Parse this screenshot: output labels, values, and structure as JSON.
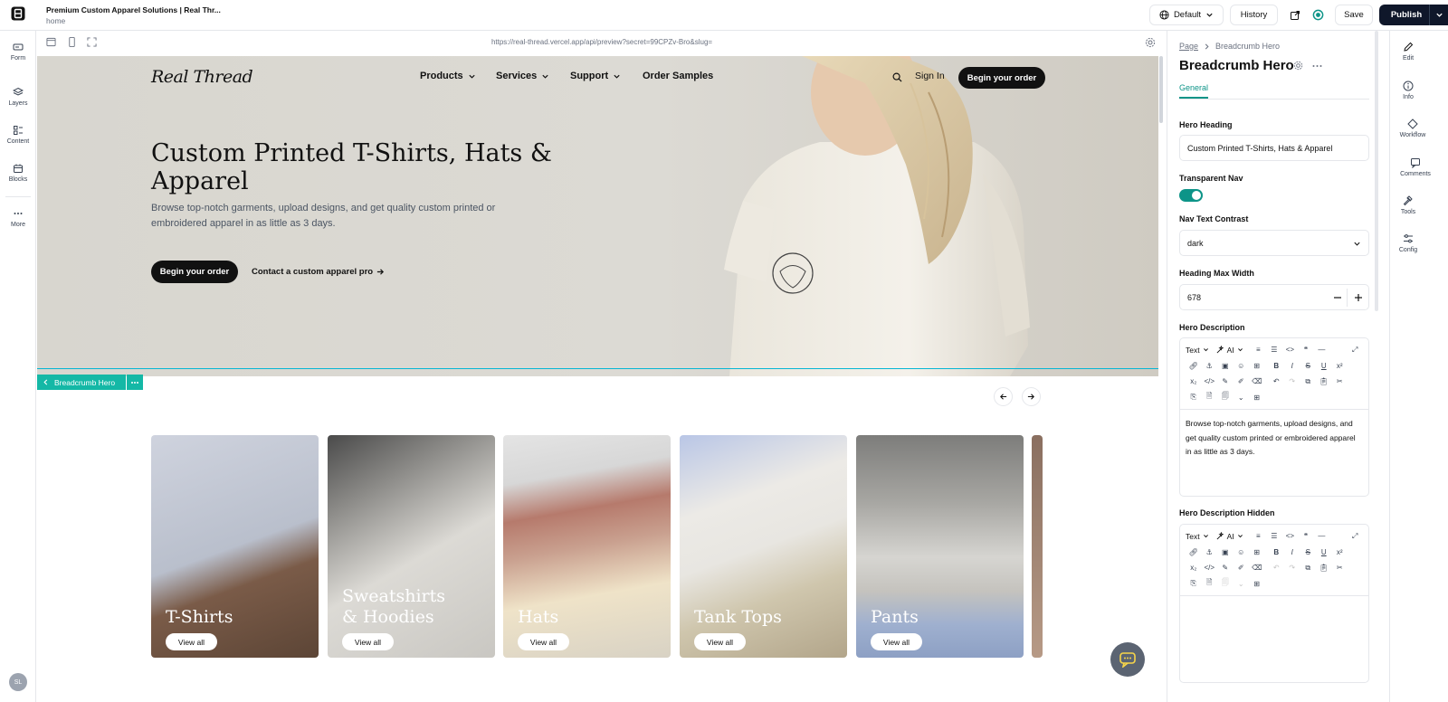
{
  "topbar": {
    "title": "Premium Custom Apparel Solutions | Real Thr...",
    "subtitle": "home",
    "locale_label": "Default",
    "history_label": "History",
    "save_label": "Save",
    "publish_label": "Publish"
  },
  "leftrail": {
    "items": [
      {
        "label": "Form",
        "icon": "form-icon"
      },
      {
        "label": "Layers",
        "icon": "layers-icon"
      },
      {
        "label": "Content",
        "icon": "content-icon"
      },
      {
        "label": "Blocks",
        "icon": "blocks-icon"
      },
      {
        "label": "More",
        "icon": "more-icon"
      }
    ],
    "avatar": "SL"
  },
  "preview": {
    "url": "https://real-thread.vercel.app/api/preview?secret=99CPZv-Bro&slug="
  },
  "site": {
    "brand": "Real Thread",
    "nav": [
      "Products",
      "Services",
      "Support",
      "Order Samples"
    ],
    "signin": "Sign In",
    "nav_cta": "Begin your order",
    "hero_heading": "Custom Printed T-Shirts, Hats & Apparel",
    "hero_description": "Browse top-notch garments, upload designs, and get quality custom printed or embroidered apparel in as little as 3 days.",
    "hero_cta": "Begin your order",
    "hero_link": "Contact a custom apparel pro",
    "selection_label": "Breadcrumb Hero",
    "categories": [
      {
        "title_line1": "T-Shirts",
        "title_line2": "",
        "button": "View all"
      },
      {
        "title_line1": "Sweatshirts",
        "title_line2": "& Hoodies",
        "button": "View all"
      },
      {
        "title_line1": "Hats",
        "title_line2": "",
        "button": "View all"
      },
      {
        "title_line1": "Tank Tops",
        "title_line2": "",
        "button": "View all"
      },
      {
        "title_line1": "Pants",
        "title_line2": "",
        "button": "View all"
      }
    ]
  },
  "panel": {
    "breadcrumb_root": "Page",
    "breadcrumb_current": "Breadcrumb Hero",
    "title": "Breadcrumb Hero",
    "tab": "General",
    "hero_heading_label": "Hero Heading",
    "hero_heading_value": "Custom Printed T-Shirts, Hats & Apparel",
    "transparent_nav_label": "Transparent Nav",
    "transparent_nav_on": true,
    "nav_contrast_label": "Nav Text Contrast",
    "nav_contrast_value": "dark",
    "max_width_label": "Heading Max Width",
    "max_width_value": "678",
    "hero_description_label": "Hero Description",
    "hero_description_value": "Browse top-notch garments, upload designs, and get quality custom printed or embroidered apparel in as little as 3 days.",
    "hero_description_hidden_label": "Hero Description Hidden",
    "hero_description_hidden_value": "",
    "editor_text_select": "Text",
    "editor_ai_select": "AI"
  },
  "rightrail": {
    "items": [
      {
        "label": "Edit",
        "icon": "pencil-icon"
      },
      {
        "label": "Info",
        "icon": "info-icon"
      },
      {
        "label": "Workflow",
        "icon": "workflow-icon"
      },
      {
        "label": "Comments",
        "icon": "comment-icon"
      },
      {
        "label": "Tools",
        "icon": "hammer-icon"
      },
      {
        "label": "Config",
        "icon": "sliders-icon"
      }
    ]
  },
  "colors": {
    "accent": "#0d9488",
    "selection": "#14b8a6",
    "publish": "#0f172a"
  }
}
